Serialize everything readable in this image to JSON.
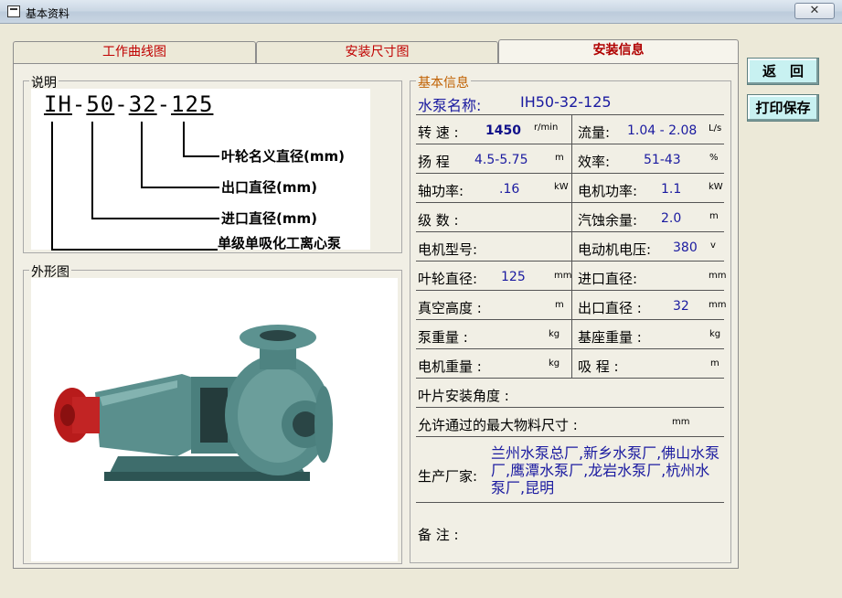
{
  "window": {
    "title": "基本资料",
    "close_symbol": "✕",
    "app_icon": "window-icon"
  },
  "tabs": [
    "工作曲线图",
    "安装尺寸图",
    "安装信息"
  ],
  "buttons": {
    "back": "返　回",
    "print_save": "打印保存"
  },
  "description": {
    "group_label": "说明",
    "model_parts": [
      "IH",
      "-",
      "50",
      "-",
      "32",
      "-",
      "125"
    ],
    "callouts": [
      "叶轮名义直径(mm)",
      "出口直径(mm)",
      "进口直径(mm)",
      "单级单吸化工离心泵"
    ]
  },
  "appearance": {
    "group_label": "外形图",
    "image": "centrifugal-pump-photo"
  },
  "info": {
    "group_label": "基本信息",
    "pump_name_label": "水泵名称:",
    "pump_name": "IH50-32-125",
    "rows": [
      {
        "left": {
          "label": "转 速 :",
          "value": "1450",
          "unit": "r/min"
        },
        "right": {
          "label": "流量:",
          "value": "1.04 - 2.08",
          "unit": "L/s"
        }
      },
      {
        "left": {
          "label": "扬 程",
          "value": "4.5-5.75",
          "unit": "m"
        },
        "right": {
          "label": "效率:",
          "value": "51-43",
          "unit": "%"
        }
      },
      {
        "left": {
          "label": "轴功率:",
          "value": ".16",
          "unit": "kW"
        },
        "right": {
          "label": "电机功率:",
          "value": "1.1",
          "unit": "kW"
        }
      },
      {
        "left": {
          "label": "级 数 :",
          "value": "",
          "unit": ""
        },
        "right": {
          "label": "汽蚀余量:",
          "value": "2.0",
          "unit": "m"
        }
      },
      {
        "left": {
          "label": "电机型号:",
          "value": "",
          "unit": ""
        },
        "right": {
          "label": "电动机电压:",
          "value": "380",
          "unit": "v"
        }
      },
      {
        "left": {
          "label": "叶轮直径:",
          "value": "125",
          "unit": "mm"
        },
        "right": {
          "label": "进口直径:",
          "value": "",
          "unit": "mm"
        }
      },
      {
        "left": {
          "label": "真空高度 :",
          "value": "",
          "unit": "m"
        },
        "right": {
          "label": "出口直径 :",
          "value": "32",
          "unit": "mm"
        }
      },
      {
        "left": {
          "label": "泵重量 :",
          "value": "",
          "unit": "kg"
        },
        "right": {
          "label": "基座重量 :",
          "value": "",
          "unit": "kg"
        }
      },
      {
        "left": {
          "label": "电机重量 :",
          "value": "",
          "unit": "kg"
        },
        "right": {
          "label": "吸 程 :",
          "value": "",
          "unit": "m"
        }
      }
    ],
    "blade_angle_label": "叶片安装角度 :",
    "max_particle_label": "允许通过的最大物料尺寸 :",
    "max_particle_unit": "mm",
    "manufacturer_label": "生产厂家:",
    "manufacturers": "兰州水泵总厂,新乡水泵厂,佛山水泵厂,鹰潭水泵厂,龙岩水泵厂,杭州水泵厂,昆明",
    "remarks_label": "备 注 :"
  }
}
